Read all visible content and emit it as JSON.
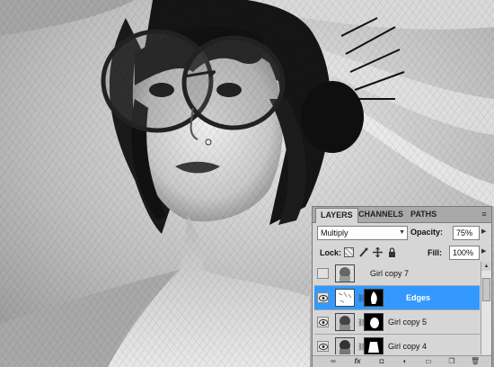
{
  "panel": {
    "tabs": [
      {
        "label": "LAYERS",
        "active": true
      },
      {
        "label": "CHANNELS",
        "active": false
      },
      {
        "label": "PATHS",
        "active": false
      }
    ],
    "menu_icon": "panel-menu-icon",
    "blend_mode": "Multiply",
    "opacity_label": "Opacity:",
    "opacity_value": "75%",
    "lock_label": "Lock:",
    "lock_icons": [
      "lock-transparent-icon",
      "lock-image-icon",
      "lock-position-icon",
      "lock-all-icon"
    ],
    "fill_label": "Fill:",
    "fill_value": "100%",
    "layers": [
      {
        "name": "Girl copy 7",
        "visible": false,
        "selected": false,
        "has_mask": false
      },
      {
        "name": "Edges",
        "visible": true,
        "selected": true,
        "has_mask": true
      },
      {
        "name": "Girl copy 5",
        "visible": true,
        "selected": false,
        "has_mask": true
      },
      {
        "name": "Girl copy 4",
        "visible": true,
        "selected": false,
        "has_mask": true
      }
    ],
    "footer_icons": [
      "link-layers-icon",
      "fx-icon",
      "add-mask-icon",
      "adjustment-icon",
      "group-icon",
      "new-layer-icon",
      "delete-icon"
    ],
    "colors": {
      "selection": "#3399ff",
      "panel_bg": "#d6d6d6",
      "tab_bar": "#a9a9a9"
    }
  }
}
